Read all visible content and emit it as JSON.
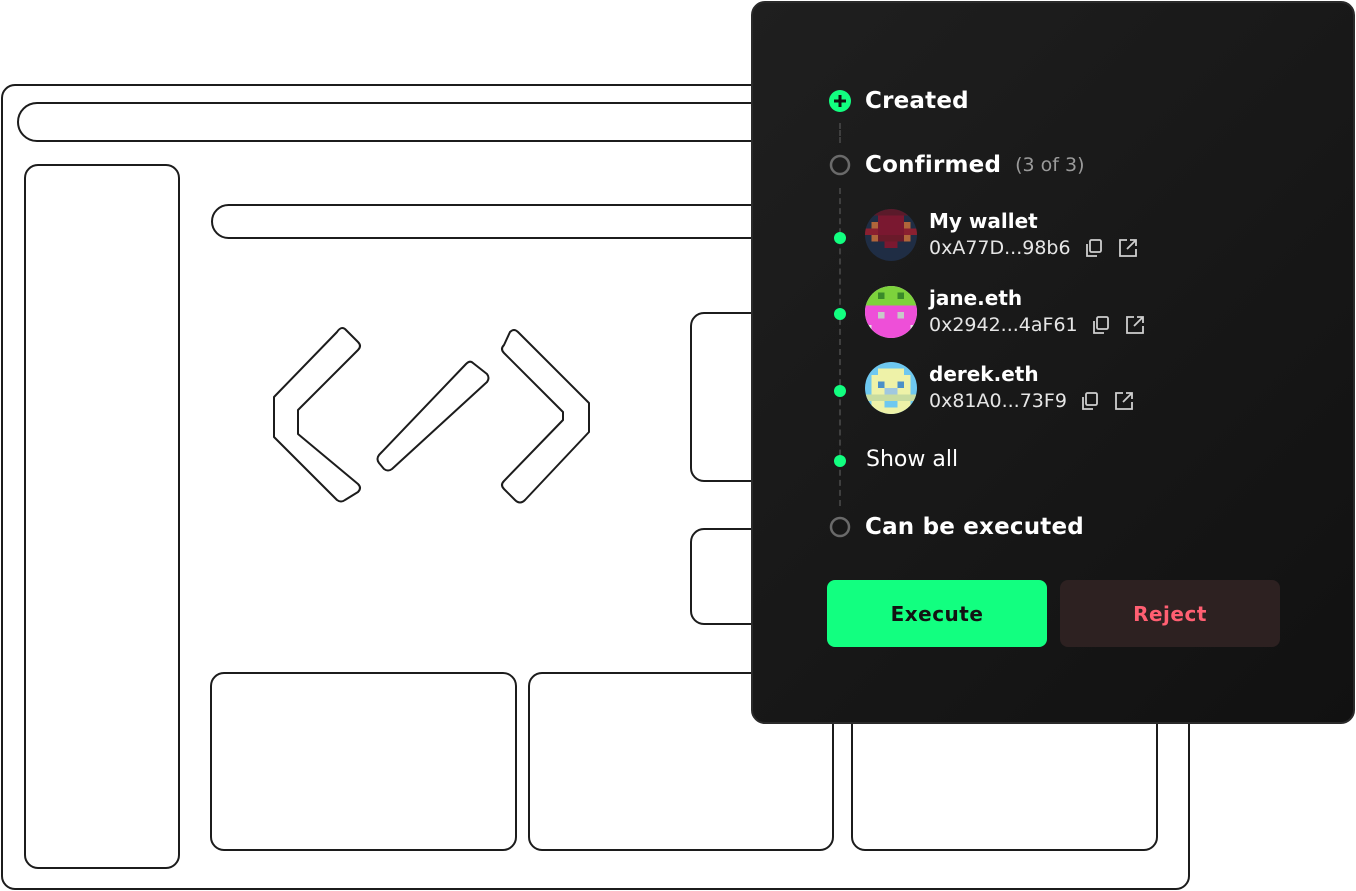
{
  "panel": {
    "steps": {
      "created": {
        "label": "Created"
      },
      "confirmed": {
        "label": "Confirmed",
        "count": "(3 of 3)"
      },
      "executable": {
        "label": "Can be executed"
      }
    },
    "owners": [
      {
        "name": "My wallet",
        "address": "0xA77D...98b6",
        "avatar_icon": "pixel-identicon-red"
      },
      {
        "name": "jane.eth",
        "address": "0x2942...4aF61",
        "avatar_icon": "pixel-identicon-green-pink"
      },
      {
        "name": "derek.eth",
        "address": "0x81A0...73F9",
        "avatar_icon": "pixel-identicon-blue-yellow"
      }
    ],
    "show_all": "Show all",
    "actions": {
      "execute": "Execute",
      "reject": "Reject"
    }
  },
  "colors": {
    "accent": "#12ff80",
    "panel_bg": "#1a1a1a",
    "reject_bg": "#2d2121",
    "reject_text": "#ff5f72",
    "muted": "#9a9a9a"
  }
}
